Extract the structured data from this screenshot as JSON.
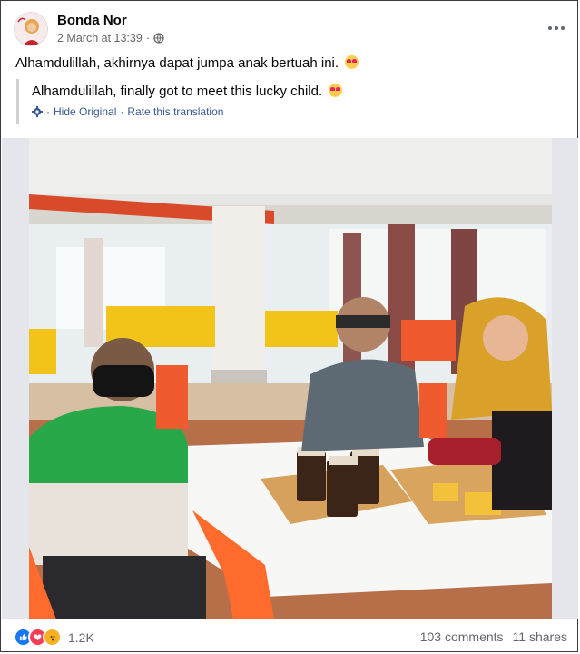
{
  "post": {
    "author": "Bonda Nor",
    "timestamp": "2 March at 13:39",
    "separator": "·",
    "privacy_icon": "globe-icon",
    "text": "Alhamdulillah, akhirnya dapat jumpa anak bertuah ini.",
    "emoji": "heart-eyes-emoji"
  },
  "translation": {
    "text": "Alhamdulillah, finally got to meet this lucky child.",
    "hide_label": "Hide Original",
    "rate_label": "Rate this translation",
    "link_separator": "·"
  },
  "photo": {
    "description_icon": "photo"
  },
  "footer": {
    "reactions": [
      "like",
      "love",
      "wow"
    ],
    "reaction_count": "1.2K",
    "comments": "103 comments",
    "shares": "11 shares"
  },
  "colors": {
    "link": "#385898",
    "meta": "#65676b",
    "like": "#1877f2",
    "love": "#f33e58",
    "wow": "#f7b125"
  }
}
